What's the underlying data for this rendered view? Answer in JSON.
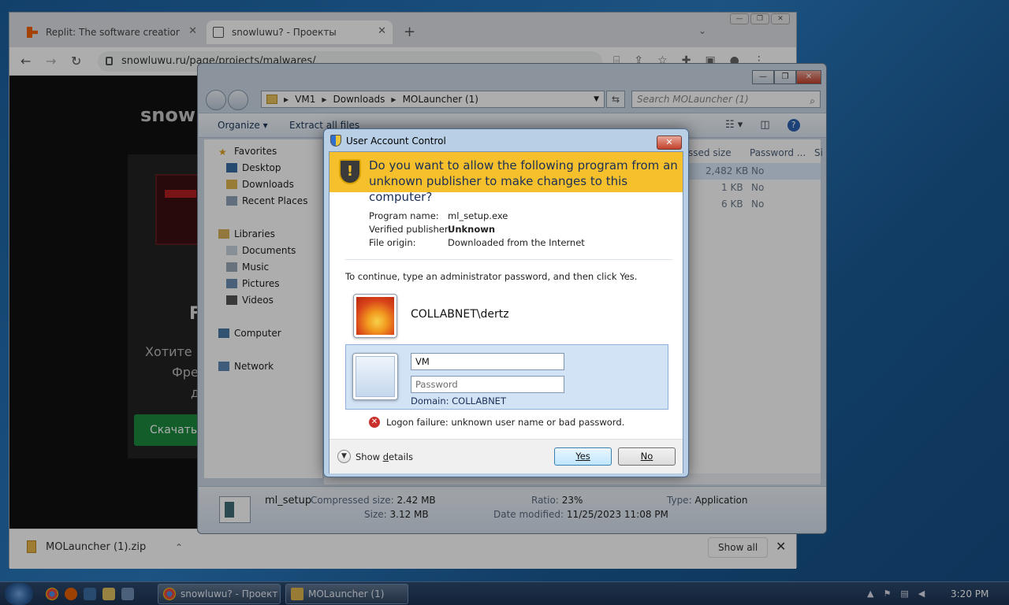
{
  "browser": {
    "tabs": [
      {
        "title": "Replit: The software creation pla"
      },
      {
        "title": "snowluwu? - Проекты"
      }
    ],
    "new_tab": "+",
    "url": "snowluwu.ru/page/projects/malwares/",
    "page": {
      "logo": "snowl",
      "heading": "F",
      "text_lines": [
        "Хотите г",
        "Фред,",
        "де"
      ],
      "download_button": "Скачать"
    },
    "download_bar": {
      "file_name": "MOLauncher (1).zip",
      "show_all": "Show all"
    }
  },
  "explorer": {
    "breadcrumb": [
      "VM1",
      "Downloads",
      "MOLauncher (1)"
    ],
    "search_placeholder": "Search MOLauncher (1)",
    "commands": {
      "organize": "Organize ▾",
      "extract": "Extract all files"
    },
    "nav": {
      "favorites": "Favorites",
      "desktop": "Desktop",
      "downloads": "Downloads",
      "recent": "Recent Places",
      "libraries": "Libraries",
      "documents": "Documents",
      "music": "Music",
      "pictures": "Pictures",
      "videos": "Videos",
      "computer": "Computer",
      "network": "Network"
    },
    "columns": {
      "compressed": "ssed size",
      "password": "Password ...",
      "extra": "Si"
    },
    "rows": [
      {
        "size": "2,482 KB",
        "password": "No"
      },
      {
        "size": "1 KB",
        "password": "No"
      },
      {
        "size": "6 KB",
        "password": "No"
      }
    ],
    "details": {
      "name": "ml_setup",
      "compressed_label": "Compressed size:",
      "compressed_value": "2.42 MB",
      "size_label": "Size:",
      "size_value": "3.12 MB",
      "ratio_label": "Ratio:",
      "ratio_value": "23%",
      "modified_label": "Date modified:",
      "modified_value": "11/25/2023 11:08 PM",
      "type_label": "Type:",
      "type_value": "Application"
    }
  },
  "uac": {
    "title": "User Account Control",
    "question": "Do you want to allow the following program from an unknown publisher to make changes to this computer?",
    "program_name_label": "Program name:",
    "program_name": "ml_setup.exe",
    "publisher_label": "Verified publisher:",
    "publisher": "Unknown",
    "origin_label": "File origin:",
    "origin": "Downloaded from the Internet",
    "prompt": "To continue, type an administrator password, and then click Yes.",
    "account": "COLLABNET\\dertz",
    "username_value": "VM",
    "password_placeholder": "Password",
    "domain": "Domain: COLLABNET",
    "error": "Logon failure: unknown user name or bad password.",
    "show_details_prefix": "Show ",
    "show_details_accel": "d",
    "show_details_suffix": "etails",
    "yes": "Yes",
    "no": "No"
  },
  "taskbar": {
    "buttons": [
      {
        "label": "snowluwu? - Проект"
      },
      {
        "label": "MOLauncher (1)"
      }
    ],
    "clock": "3:20 PM"
  }
}
